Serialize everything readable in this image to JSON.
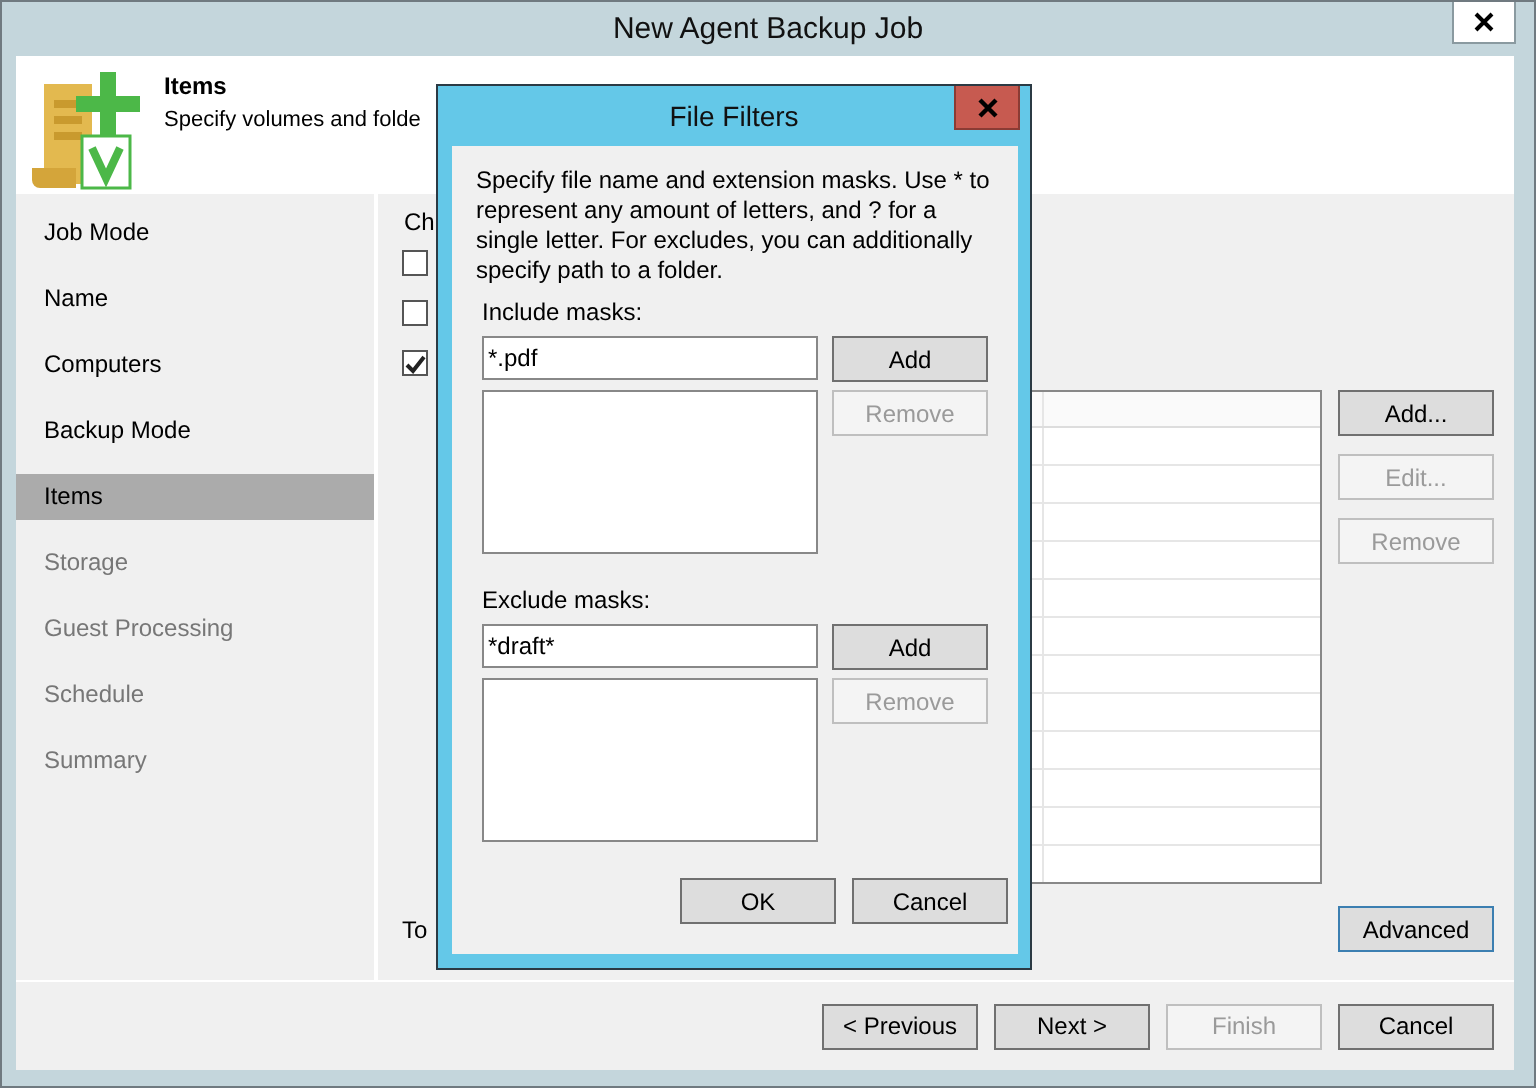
{
  "window": {
    "title": "New Agent Backup Job"
  },
  "header": {
    "title": "Items",
    "subtitle": "Specify volumes and folde"
  },
  "sidebar": {
    "items": [
      {
        "label": "Job Mode",
        "selected": false,
        "disabled": false
      },
      {
        "label": "Name",
        "selected": false,
        "disabled": false
      },
      {
        "label": "Computers",
        "selected": false,
        "disabled": false
      },
      {
        "label": "Backup Mode",
        "selected": false,
        "disabled": false
      },
      {
        "label": "Items",
        "selected": true,
        "disabled": false
      },
      {
        "label": "Storage",
        "selected": false,
        "disabled": true
      },
      {
        "label": "Guest Processing",
        "selected": false,
        "disabled": true
      },
      {
        "label": "Schedule",
        "selected": false,
        "disabled": true
      },
      {
        "label": "Summary",
        "selected": false,
        "disabled": true
      }
    ]
  },
  "content": {
    "label": "Ch",
    "checkboxes": [
      {
        "checked": false
      },
      {
        "checked": false
      },
      {
        "checked": true
      }
    ],
    "list_buttons": [
      {
        "label": "Add...",
        "disabled": false
      },
      {
        "label": "Edit...",
        "disabled": true
      },
      {
        "label": "Remove",
        "disabled": true
      }
    ],
    "bottom_label": "To",
    "advanced_button": {
      "label": "Advanced",
      "focused": true
    }
  },
  "footer": {
    "buttons": [
      {
        "label": "< Previous",
        "disabled": false
      },
      {
        "label": "Next >",
        "disabled": false
      },
      {
        "label": "Finish",
        "disabled": true
      },
      {
        "label": "Cancel",
        "disabled": false
      }
    ]
  },
  "dialog": {
    "title": "File Filters",
    "description": "Specify file name and extension masks. Use * to represent any amount of letters, and ? for a single letter. For excludes, you can additionally specify path to a folder.",
    "sections": [
      {
        "label": "Include masks:",
        "value": "*.pdf",
        "add": {
          "label": "Add",
          "disabled": false
        },
        "remove": {
          "label": "Remove",
          "disabled": true
        }
      },
      {
        "label": "Exclude masks:",
        "value": "*draft*",
        "add": {
          "label": "Add",
          "disabled": false
        },
        "remove": {
          "label": "Remove",
          "disabled": true
        }
      }
    ],
    "buttons": [
      {
        "label": "OK"
      },
      {
        "label": "Cancel"
      }
    ]
  }
}
